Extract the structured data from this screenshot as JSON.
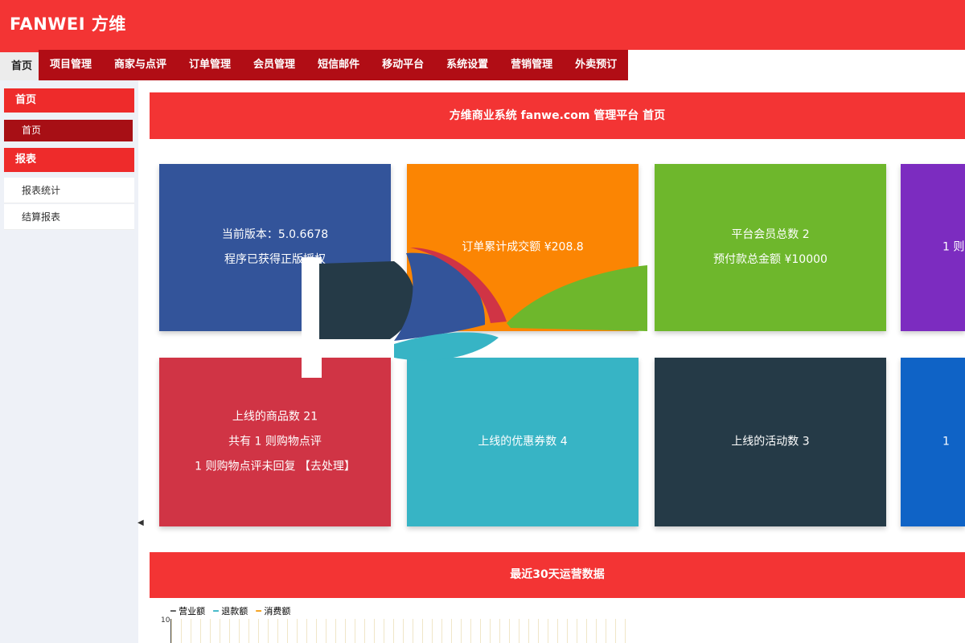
{
  "header": {
    "logo": "FANWEI  方维",
    "bg": "#f33434"
  },
  "nav": {
    "tabs": [
      "首页",
      "项目管理",
      "商家与点评",
      "订单管理",
      "会员管理",
      "短信邮件",
      "移动平台",
      "系统设置",
      "营销管理",
      "外卖预订"
    ]
  },
  "sidebar": {
    "group1": "首页",
    "active_item": "首页",
    "group2": "报表",
    "items": [
      "报表统计",
      "结算报表"
    ]
  },
  "main": {
    "title": "方维商业系统 fanwe.com 管理平台 首页",
    "stats_title": "最近30天运营数据"
  },
  "tiles": {
    "version": {
      "line1": "当前版本：5.0.6678",
      "line2": "程序已获得正版授权",
      "color": "#33549a"
    },
    "orders": {
      "line1": "订单累计成交额 ¥208.8",
      "color": "#fb8503"
    },
    "members": {
      "line1": "平台会员总数 2",
      "line2": "预付款总金额 ¥10000",
      "color": "#6eb72c"
    },
    "purple": {
      "line1": "1 则",
      "color": "#7c2cc0"
    },
    "goods": {
      "line1": "上线的商品数 21",
      "line2": "共有 1 则购物点评",
      "line3": "1 则购物点评未回复 【去处理】",
      "color": "#d03445"
    },
    "coupons": {
      "line1": "上线的优惠券数 4",
      "color": "#37b4c5"
    },
    "events": {
      "line1": "上线的活动数 3",
      "color": "#253a47"
    },
    "blue": {
      "line1": "1",
      "color": "#0f63c6"
    }
  },
  "chart_data": {
    "type": "line",
    "series": [
      {
        "name": "营业额",
        "color": "#555555"
      },
      {
        "name": "退款额",
        "color": "#37b4c5"
      },
      {
        "name": "消费额",
        "color": "#f39c12"
      }
    ],
    "y_tick": "10"
  }
}
